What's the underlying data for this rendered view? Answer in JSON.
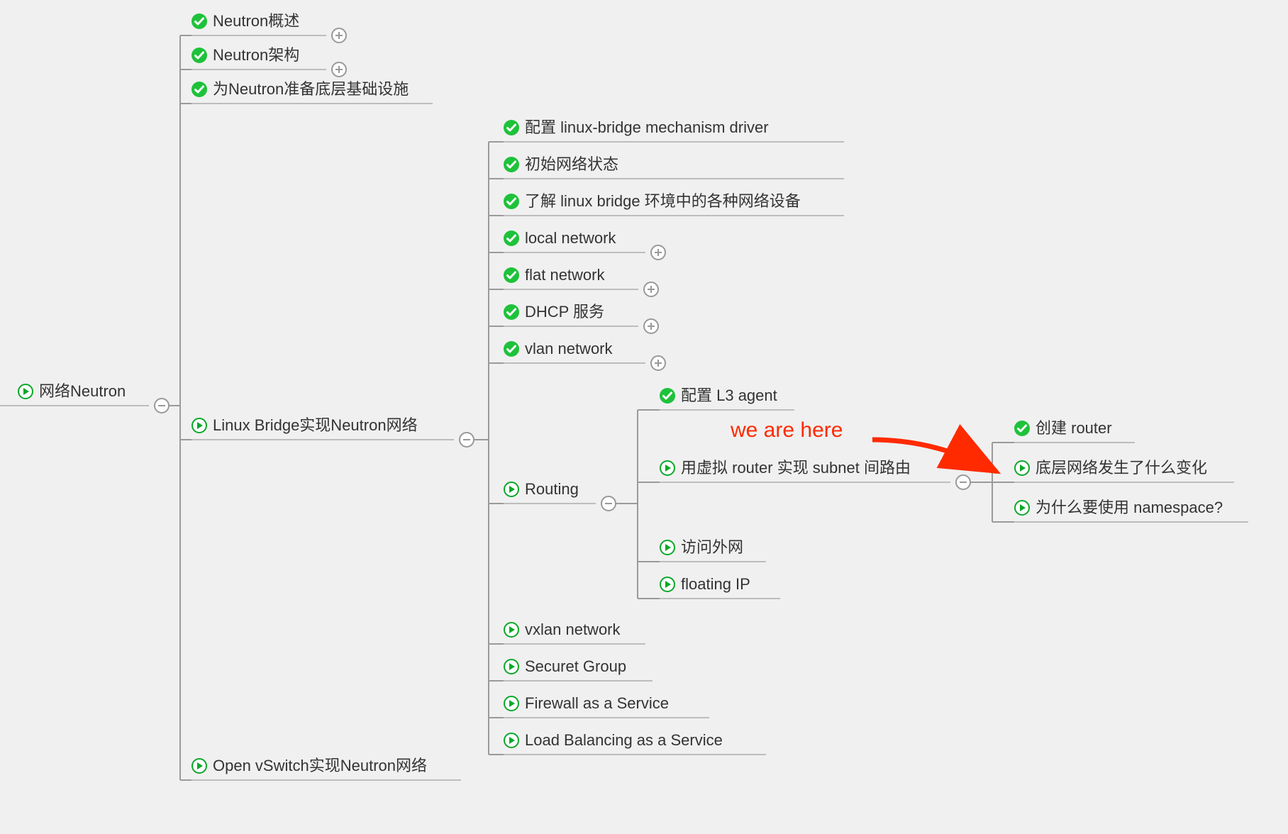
{
  "annotation": {
    "label": "we are here"
  },
  "icons": {
    "check": "check-icon",
    "play": "play-icon",
    "plus": "plus-icon",
    "minus": "minus-icon"
  },
  "colors": {
    "green": "#1ec23a",
    "greenDark": "#0aa828",
    "line": "#9a9a9a",
    "underline": "#bdbdbd",
    "red": "#ff2a00",
    "bg": "#f0f0f0"
  },
  "root": {
    "label": "网络Neutron",
    "icon": "play",
    "toggle": "minus"
  },
  "level1": [
    {
      "id": "n1",
      "label": "Neutron概述",
      "icon": "check",
      "toggle": "plus"
    },
    {
      "id": "n2",
      "label": "Neutron架构",
      "icon": "check",
      "toggle": "plus"
    },
    {
      "id": "n3",
      "label": "为Neutron准备底层基础设施",
      "icon": "check",
      "toggle": null
    },
    {
      "id": "n4",
      "label": "Linux Bridge实现Neutron网络",
      "icon": "play",
      "toggle": "minus"
    },
    {
      "id": "n5",
      "label": "Open vSwitch实现Neutron网络",
      "icon": "play",
      "toggle": null
    }
  ],
  "level2": [
    {
      "id": "m1",
      "label": "配置 linux-bridge mechanism driver",
      "icon": "check",
      "toggle": null
    },
    {
      "id": "m2",
      "label": "初始网络状态",
      "icon": "check",
      "toggle": null
    },
    {
      "id": "m3",
      "label": "了解 linux bridge 环境中的各种网络设备",
      "icon": "check",
      "toggle": null
    },
    {
      "id": "m4",
      "label": "local network",
      "icon": "check",
      "toggle": "plus"
    },
    {
      "id": "m5",
      "label": "flat network",
      "icon": "check",
      "toggle": "plus"
    },
    {
      "id": "m6",
      "label": "DHCP 服务",
      "icon": "check",
      "toggle": "plus"
    },
    {
      "id": "m7",
      "label": "vlan network",
      "icon": "check",
      "toggle": "plus"
    },
    {
      "id": "m8",
      "label": "Routing",
      "icon": "play",
      "toggle": "minus"
    },
    {
      "id": "m9",
      "label": "vxlan network",
      "icon": "play",
      "toggle": null
    },
    {
      "id": "m10",
      "label": "Securet Group",
      "icon": "play",
      "toggle": null
    },
    {
      "id": "m11",
      "label": "Firewall as a Service",
      "icon": "play",
      "toggle": null
    },
    {
      "id": "m12",
      "label": "Load Balancing as a Service",
      "icon": "play",
      "toggle": null
    }
  ],
  "level3": [
    {
      "id": "r1",
      "label": "配置 L3 agent",
      "icon": "check",
      "toggle": null
    },
    {
      "id": "r2",
      "label": "用虚拟 router 实现 subnet 间路由",
      "icon": "play",
      "toggle": "minus"
    },
    {
      "id": "r3",
      "label": "访问外网",
      "icon": "play",
      "toggle": null
    },
    {
      "id": "r4",
      "label": "floating IP",
      "icon": "play",
      "toggle": null
    }
  ],
  "level4": [
    {
      "id": "s1",
      "label": "创建 router",
      "icon": "check",
      "toggle": null
    },
    {
      "id": "s2",
      "label": "底层网络发生了什么变化",
      "icon": "play",
      "toggle": null
    },
    {
      "id": "s3",
      "label": "为什么要使用 namespace?",
      "icon": "play",
      "toggle": null
    }
  ]
}
